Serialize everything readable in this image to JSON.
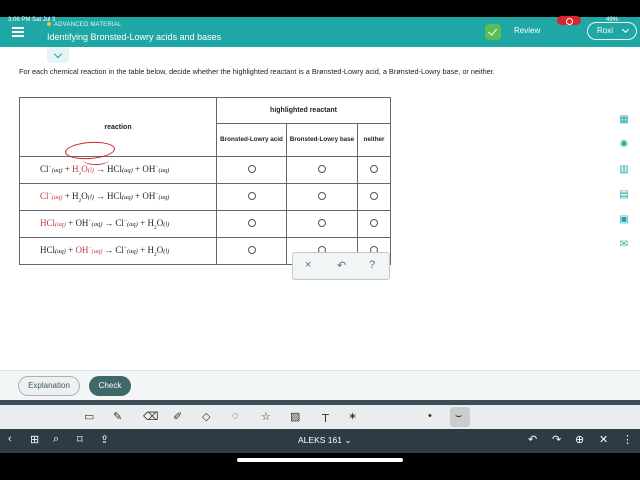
{
  "status": {
    "time": "3:06 PM",
    "date": "Sat Jul 3",
    "battery": "49%"
  },
  "header": {
    "kicker": "ADVANCED MATERIAL",
    "topic": "Identifying Bronsted-Lowry acids and bases",
    "review_label": "Review",
    "user_name": "Roxi"
  },
  "instructions": "For each chemical reaction in the table below, decide whether the highlighted reactant is a Brønsted-Lowry acid, a Brønsted-Lowry base, or neither.",
  "table": {
    "reaction_header": "reaction",
    "group_header": "highlighted reactant",
    "columns": [
      "Bronsted-Lowry acid",
      "Bronsted-Lowry base",
      "neither"
    ],
    "rows": [
      {
        "a": "Cl",
        "a_sup": "−",
        "a_state": "(aq)",
        "plus": "+",
        "b": "H",
        "b_sub": "2",
        "b_rest": "O",
        "b_state": "(l)",
        "arrow": "→",
        "c": "HCl",
        "c_state": "(aq)",
        "plus2": "+",
        "d": "OH",
        "d_sup": "−",
        "d_state": "(aq)",
        "highlight": "b"
      },
      {
        "a": "Cl",
        "a_sup": "−",
        "a_state": "(aq)",
        "plus": "+",
        "b": "H",
        "b_sub": "2",
        "b_rest": "O",
        "b_state": "(l)",
        "arrow": "→",
        "c": "HCl",
        "c_state": "(aq)",
        "plus2": "+",
        "d": "OH",
        "d_sup": "−",
        "d_state": "(aq)",
        "highlight": "a"
      },
      {
        "a": "HCl",
        "a_state": "(aq)",
        "plus": "+",
        "b": "OH",
        "b_sup": "−",
        "b_state": "(aq)",
        "arrow": "→",
        "c": "Cl",
        "c_sup": "−",
        "c_state": "(aq)",
        "plus2": "+",
        "d": "H",
        "d_sub": "2",
        "d_rest": "O",
        "d_state": "(l)",
        "highlight": "a"
      },
      {
        "a": "HCl",
        "a_state": "(aq)",
        "plus": "+",
        "b": "OH",
        "b_sup": "−",
        "b_state": "(aq)",
        "arrow": "→",
        "c": "Cl",
        "c_sup": "−",
        "c_state": "(aq)",
        "plus2": "+",
        "d": "H",
        "d_sub": "2",
        "d_rest": "O",
        "d_state": "(l)",
        "highlight": "b"
      }
    ]
  },
  "answer_tools": {
    "clear": "×",
    "undo": "↶",
    "help": "?"
  },
  "footer": {
    "explanation_label": "Explanation",
    "check_label": "Check"
  },
  "bottom": {
    "doc_title": "ALEKS 161",
    "doc_title_chevron": "⌄"
  },
  "colors": {
    "brand": "#1fa7a6",
    "highlight": "#c23a3a",
    "ink": "#c8242b",
    "check_button": "#3f6869"
  }
}
